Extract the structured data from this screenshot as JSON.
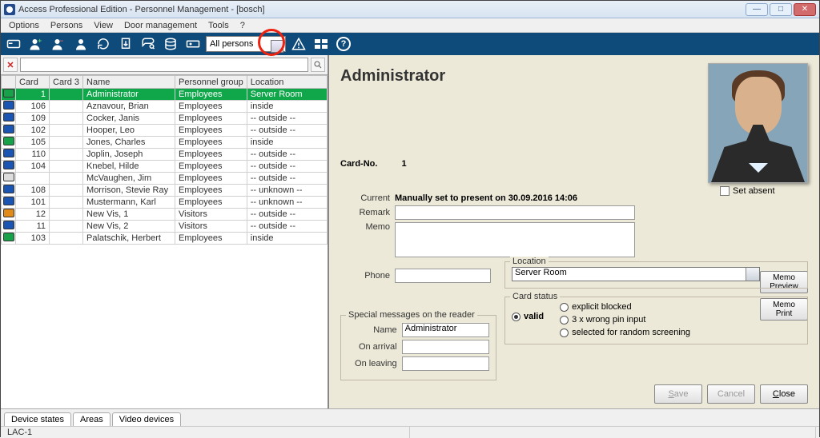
{
  "window": {
    "title": "Access Professional Edition - Personnel Management - [bosch]"
  },
  "menu": [
    "Options",
    "Persons",
    "View",
    "Door management",
    "Tools",
    "?"
  ],
  "toolbar": {
    "filter_select": "All persons"
  },
  "table": {
    "headers": [
      "",
      "Card",
      "Card 3",
      "Name",
      "Personnel group",
      "Location"
    ],
    "rows": [
      {
        "dot": "green",
        "card": "1",
        "card3": "",
        "name": "Administrator",
        "group": "Employees",
        "loc": "Server Room",
        "sel": true
      },
      {
        "dot": "blue",
        "card": "106",
        "card3": "",
        "name": "Aznavour, Brian",
        "group": "Employees",
        "loc": "inside"
      },
      {
        "dot": "blue",
        "card": "109",
        "card3": "",
        "name": "Cocker, Janis",
        "group": "Employees",
        "loc": "-- outside --"
      },
      {
        "dot": "blue",
        "card": "102",
        "card3": "",
        "name": "Hooper, Leo",
        "group": "Employees",
        "loc": "-- outside --"
      },
      {
        "dot": "green",
        "card": "105",
        "card3": "",
        "name": "Jones, Charles",
        "group": "Employees",
        "loc": "inside"
      },
      {
        "dot": "blue",
        "card": "110",
        "card3": "",
        "name": "Joplin, Joseph",
        "group": "Employees",
        "loc": "-- outside --"
      },
      {
        "dot": "blue",
        "card": "104",
        "card3": "",
        "name": "Knebel, Hilde",
        "group": "Employees",
        "loc": "-- outside --"
      },
      {
        "dot": "grey",
        "card": "",
        "card3": "",
        "name": "McVaughen, Jim",
        "group": "Employees",
        "loc": "-- outside --"
      },
      {
        "dot": "blue",
        "card": "108",
        "card3": "",
        "name": "Morrison, Stevie Ray",
        "group": "Employees",
        "loc": "-- unknown --"
      },
      {
        "dot": "blue",
        "card": "101",
        "card3": "",
        "name": "Mustermann, Karl",
        "group": "Employees",
        "loc": "-- unknown --"
      },
      {
        "dot": "orange",
        "card": "12",
        "card3": "",
        "name": "New Vis, 1",
        "group": "Visitors",
        "loc": "-- outside --"
      },
      {
        "dot": "blue",
        "card": "11",
        "card3": "",
        "name": "New Vis, 2",
        "group": "Visitors",
        "loc": "-- outside --"
      },
      {
        "dot": "green",
        "card": "103",
        "card3": "",
        "name": "Palatschik, Herbert",
        "group": "Employees",
        "loc": "inside"
      }
    ]
  },
  "detail": {
    "name": "Administrator",
    "cardno_label": "Card-No.",
    "cardno_value": "1",
    "current_label": "Current",
    "current_value": "Manually set to present on 30.09.2016 14:06",
    "set_absent_label": "Set absent",
    "remark_label": "Remark",
    "memo_label": "Memo",
    "phone_label": "Phone",
    "location_label": "Location",
    "location_value": "Server Room",
    "special_legend": "Special messages on the reader",
    "special_name_label": "Name",
    "special_name_value": "Administrator",
    "on_arrival_label": "On arrival",
    "on_leaving_label": "On leaving",
    "cardstatus_legend": "Card status",
    "valid_label": "valid",
    "explicit_blocked_label": "explicit blocked",
    "wrong_pin_label": "3 x wrong pin input",
    "random_screening_label": "selected for random screening",
    "memo_preview_btn": "Memo\nPreview",
    "memo_print_btn": "Memo\nPrint",
    "save_btn": "Save",
    "cancel_btn": "Cancel",
    "close_btn": "Close"
  },
  "bottom_tabs": [
    "Device states",
    "Areas",
    "Video devices"
  ],
  "status_left": "LAC-1"
}
